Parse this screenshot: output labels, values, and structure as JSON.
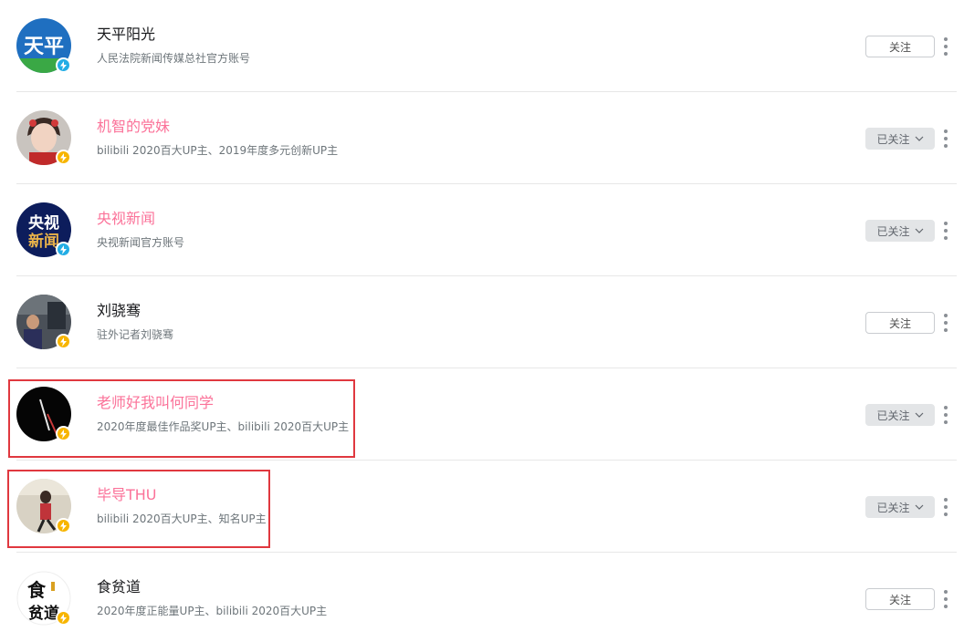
{
  "colors": {
    "vip_name": "#fb7299",
    "normal_name": "#18191c",
    "sign": "#6d757a",
    "highlight_box": "#e0383f",
    "badge_blue": "#23ade5",
    "badge_yellow": "#f7b500"
  },
  "users": [
    {
      "name": "天平阳光",
      "sign": "人民法院新闻传媒总社官方账号",
      "vip": false,
      "followed": false,
      "follow_label": "关注",
      "badge": "blue-lightning-icon",
      "avatar_text": "天平"
    },
    {
      "name": "机智的党妹",
      "sign": "bilibili 2020百大UP主、2019年度多元创新UP主",
      "vip": true,
      "followed": true,
      "follow_label": "已关注",
      "badge": "yellow-lightning-icon",
      "avatar_text": ""
    },
    {
      "name": "央视新闻",
      "sign": "央视新闻官方账号",
      "vip": true,
      "followed": true,
      "follow_label": "已关注",
      "badge": "blue-lightning-icon",
      "avatar_text_top": "央视",
      "avatar_text_bottom": "新闻"
    },
    {
      "name": "刘骁骞",
      "sign": "驻外记者刘骁骞",
      "vip": false,
      "followed": false,
      "follow_label": "关注",
      "badge": "yellow-lightning-icon",
      "avatar_text": ""
    },
    {
      "name": "老师好我叫何同学",
      "sign": "2020年度最佳作品奖UP主、bilibili 2020百大UP主",
      "vip": true,
      "followed": true,
      "follow_label": "已关注",
      "badge": "yellow-lightning-icon",
      "avatar_text": ""
    },
    {
      "name": "毕导THU",
      "sign": "bilibili 2020百大UP主、知名UP主",
      "vip": true,
      "followed": true,
      "follow_label": "已关注",
      "badge": "yellow-lightning-icon",
      "avatar_text": ""
    },
    {
      "name": "食贫道",
      "sign": "2020年度正能量UP主、bilibili 2020百大UP主",
      "vip": false,
      "followed": false,
      "follow_label": "关注",
      "badge": "yellow-lightning-icon",
      "avatar_text_top": "食",
      "avatar_text_bottom": "贫道"
    }
  ]
}
